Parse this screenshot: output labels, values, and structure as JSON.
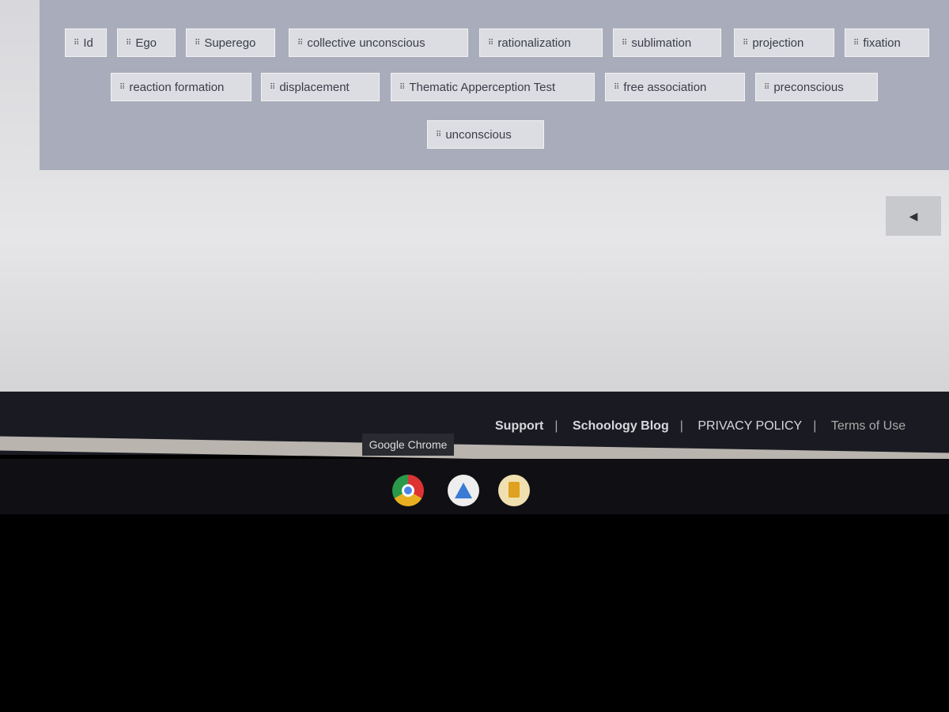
{
  "word_bank": {
    "row1": [
      "Id",
      "Ego",
      "Superego",
      "collective unconscious",
      "rationalization",
      "sublimation",
      "projection",
      "fixation"
    ],
    "row2": [
      "reaction formation",
      "displacement",
      "Thematic Apperception Test",
      "free association",
      "preconscious"
    ],
    "row3": [
      "unconscious"
    ]
  },
  "nav_button": {
    "icon": "left-arrow-icon",
    "glyph": "◀"
  },
  "footer": {
    "links": [
      "Support",
      "Schoology Blog",
      "PRIVACY POLICY",
      "Terms of Use"
    ],
    "separator": "|"
  },
  "taskbar": {
    "tooltip": "Google Chrome",
    "apps": [
      "chrome-icon",
      "google-drive-icon",
      "google-slides-icon"
    ]
  },
  "grip_glyph": "⠿"
}
